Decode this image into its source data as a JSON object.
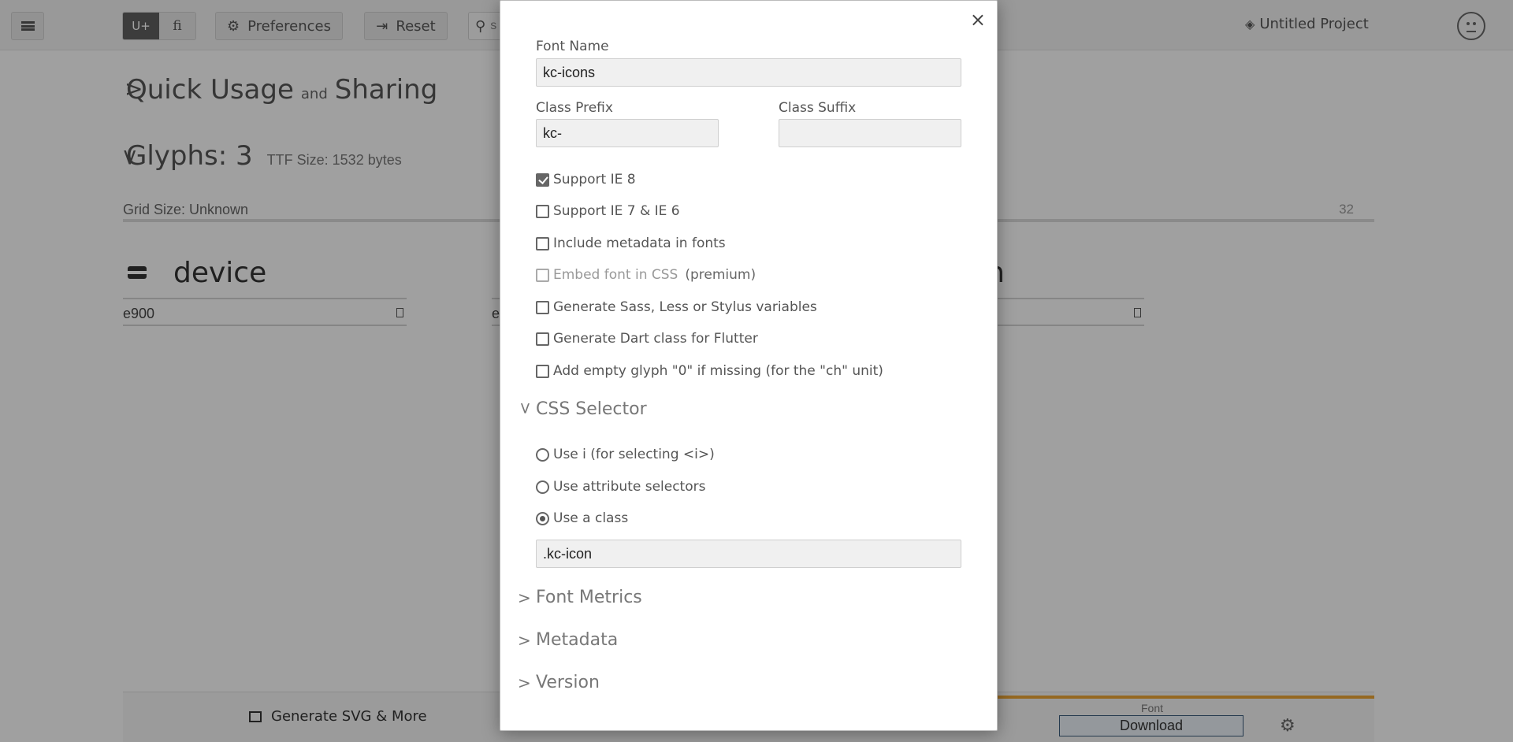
{
  "topbar": {
    "menu_icon": "hamburger-icon",
    "toggle_unicode": "U+",
    "toggle_ligature": "fi",
    "preferences_label": "Preferences",
    "reset_label": "Reset",
    "search_placeholder": "s",
    "project_name": "Untitled Project"
  },
  "main": {
    "quick_usage": "Quick Usage",
    "quick_and": "and",
    "quick_sharing": "Sharing",
    "glyphs_title": "Glyphs: 3",
    "ttf_size": "TTF Size: 1532 bytes",
    "grid_size": "Grid Size: Unknown",
    "grid_number": "32",
    "glyphs": [
      {
        "name": "device",
        "code": "e900"
      },
      {
        "name": "",
        "code": "e"
      },
      {
        "name": "en",
        "code": ""
      }
    ]
  },
  "footer": {
    "generate_label": "Generate SVG & More",
    "font_label": "Font",
    "download_label": "Download"
  },
  "modal": {
    "close": "×",
    "font_name_label": "Font Name",
    "font_name_value": "kc-icons",
    "class_prefix_label": "Class Prefix",
    "class_prefix_value": "kc-",
    "class_suffix_label": "Class Suffix",
    "class_suffix_value": "",
    "options": [
      {
        "label": "Support IE 8",
        "checked": true
      },
      {
        "label": "Support IE 7 & IE 6",
        "checked": false
      },
      {
        "label": "Include metadata in fonts",
        "checked": false
      },
      {
        "label": "Embed font in CSS",
        "extra": "(premium)",
        "checked": false,
        "disabled": true
      },
      {
        "label": "Generate Sass, Less or Stylus variables",
        "checked": false
      },
      {
        "label": "Generate Dart class for Flutter",
        "checked": false
      },
      {
        "label": "Add empty glyph \"0\" if missing (for the \"ch\" unit)",
        "checked": false
      }
    ],
    "css_selector_title": "CSS Selector",
    "selectors": [
      {
        "label": "Use i (for selecting <i>)",
        "selected": false
      },
      {
        "label": "Use attribute selectors",
        "selected": false
      },
      {
        "label": "Use a class",
        "selected": true
      }
    ],
    "class_value": ".kc-icon",
    "font_metrics_title": "Font Metrics",
    "metadata_title": "Metadata",
    "version_title": "Version"
  }
}
